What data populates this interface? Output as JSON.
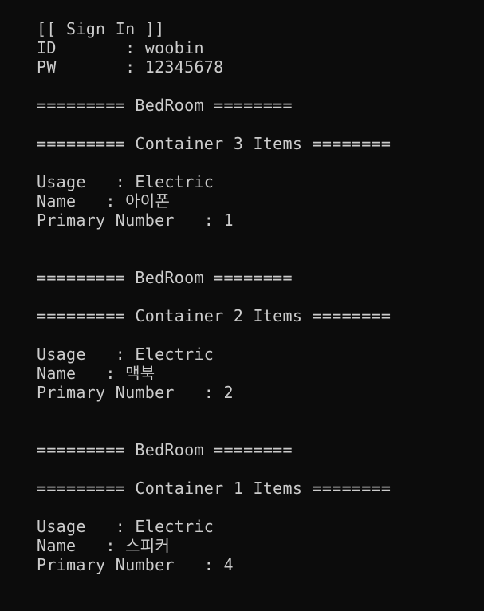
{
  "window": {
    "title": ""
  },
  "lines": [
    "[[ Sign In ]]",
    "ID       : woobin",
    "PW       : 12345678",
    "",
    "========= BedRoom ========",
    "",
    "========= Container 3 Items ========",
    "",
    "Usage   : Electric",
    "Name   : 아이폰",
    "Primary Number   : 1",
    "",
    "",
    "========= BedRoom ========",
    "",
    "========= Container 2 Items ========",
    "",
    "Usage   : Electric",
    "Name   : 맥북",
    "Primary Number   : 2",
    "",
    "",
    "========= BedRoom ========",
    "",
    "========= Container 1 Items ========",
    "",
    "Usage   : Electric",
    "Name   : 스피커",
    "Primary Number   : 4"
  ],
  "colors": {
    "background": "#0c0c0c",
    "text": "#cccccc"
  }
}
